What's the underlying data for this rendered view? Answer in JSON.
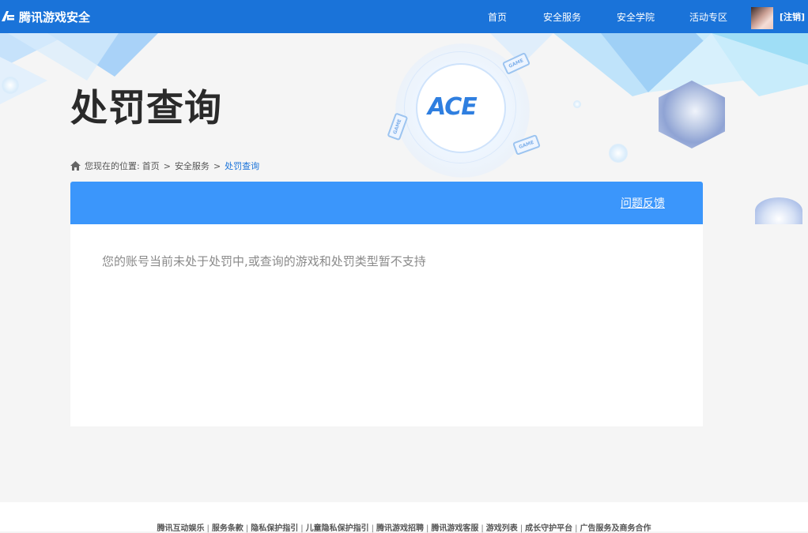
{
  "header": {
    "logo_text": "腾讯游戏安全",
    "nav": [
      "首页",
      "安全服务",
      "安全学院",
      "活动专区"
    ],
    "logout": "[注销]"
  },
  "banner": {
    "emblem_text": "ACE",
    "game_tag": "GAME"
  },
  "page": {
    "title": "处罚查询",
    "breadcrumb": {
      "prefix": "您现在的位置:",
      "items": [
        "首页",
        "安全服务",
        "处罚查询"
      ],
      "separator": ">"
    }
  },
  "panel": {
    "feedback_label": "问题反馈",
    "message": "您的账号当前未处于处罚中,或查询的游戏和处罚类型暂不支持"
  },
  "footer": {
    "links": [
      "腾讯互动娱乐",
      "服务条款",
      "隐私保护指引",
      "儿童隐私保护指引",
      "腾讯游戏招聘",
      "腾讯游戏客服",
      "游戏列表",
      "成长守护平台",
      "广告服务及商务合作"
    ],
    "divider": "|"
  },
  "colors": {
    "topbar": "#1a73d9",
    "panel_header": "#3b96fb",
    "breadcrumb_active": "#1a73d9"
  }
}
